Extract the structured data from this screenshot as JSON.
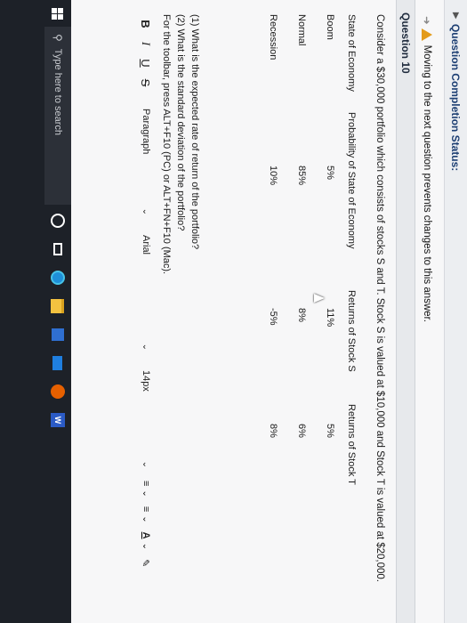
{
  "status": {
    "label": "Question Completion Status:"
  },
  "warning": {
    "text": "Moving to the next question prevents changes to this answer."
  },
  "question": {
    "title": "Question 10",
    "prompt": "Consider a $30,000 portfolio which consists of stocks S and T. Stock S is valued at $10,000 and Stock T is valued at $20,000.",
    "table": {
      "headers": [
        "State of Economy",
        "Probability of State of Economy",
        "Returns of Stock S",
        "Returns of Stock T"
      ],
      "rows": [
        [
          "Boom",
          "5%",
          "11%",
          "5%"
        ],
        [
          "Normal",
          "85%",
          "8%",
          "6%"
        ],
        [
          "Recession",
          "10%",
          "-5%",
          "8%"
        ]
      ]
    },
    "q1": "(1) What is the expected rate of return of the portfolio?",
    "q2": "(2) What is the standard deviation of the portfolio?",
    "toolbar_hint": "For the toolbar, press ALT+F10 (PC) or ALT+FN+F10 (Mac)."
  },
  "editor": {
    "bold": "B",
    "italic": "I",
    "underline": "U",
    "strike": "S",
    "paragraph": "Paragraph",
    "font": "Arial",
    "size": "14px",
    "color_a": "A"
  },
  "taskbar": {
    "search_placeholder": "Type here to search"
  }
}
